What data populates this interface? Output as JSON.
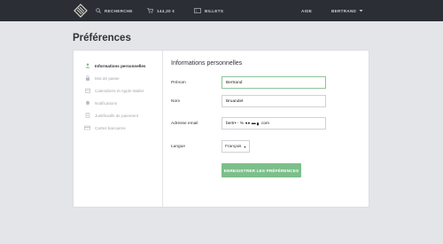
{
  "topbar": {
    "search_label": "RECHERCHE",
    "cart_label": "144,30 €",
    "tickets_label": "BILLETS",
    "help_label": "AIDE",
    "user_label": "BERTRAND"
  },
  "page": {
    "title": "Préférences"
  },
  "sidebar": {
    "items": [
      {
        "label": "Informations personnelles",
        "icon": "user-icon",
        "active": true
      },
      {
        "label": "Mot de passe",
        "icon": "lock-icon",
        "active": false
      },
      {
        "label": "Calendriers et Apple Wallet",
        "icon": "calendar-icon",
        "active": false
      },
      {
        "label": "Notifications",
        "icon": "bell-icon",
        "active": false
      },
      {
        "label": "Justificatifs de paiement",
        "icon": "document-icon",
        "active": false
      },
      {
        "label": "Cartes bancaires",
        "icon": "credit-card-icon",
        "active": false
      }
    ]
  },
  "form": {
    "title": "Informations personnelles",
    "firstname_label": "Prénom",
    "firstname_value": "Bertrand",
    "lastname_label": "Nom",
    "lastname_value": "Bruandet",
    "email_label": "Adresse email",
    "email_value": "bertr▪ ‧ % ◂ ▸ ▬ ▖ com",
    "language_label": "Langue",
    "language_value": "Français",
    "save_label": "ENREGISTRER LES PRÉFÉRENCES"
  },
  "colors": {
    "accent": "#7cbf8b",
    "topbar": "#2b2f35",
    "background": "#e4e5e8"
  }
}
